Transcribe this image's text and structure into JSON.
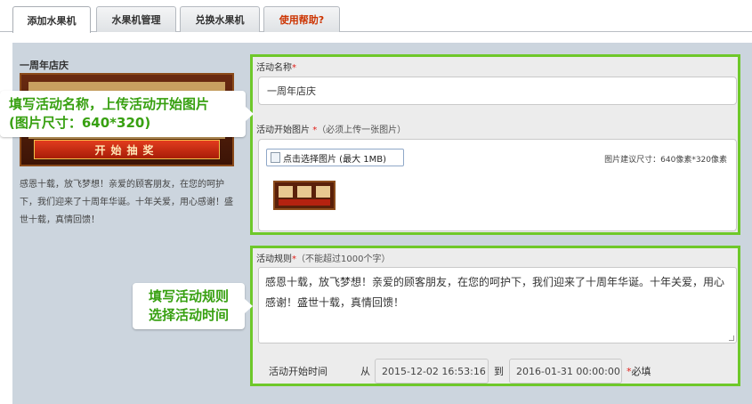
{
  "tabs": [
    {
      "label": "添加水果机",
      "active": true
    },
    {
      "label": "水果机管理",
      "active": false
    },
    {
      "label": "兑换水果机",
      "active": false
    },
    {
      "label": "使用帮助?",
      "active": false
    }
  ],
  "preview": {
    "title": "一周年店庆",
    "button_label": "开始抽奖",
    "rules_text": "感恩十载，放飞梦想！亲爱的顾客朋友，在您的呵护下，我们迎来了十周年华诞。十年关爱，用心感谢！盛世十载，真情回馈！"
  },
  "callouts": {
    "name_line1": "填写活动名称，上传活动开始图片",
    "name_line2": "(图片尺寸：640*320)",
    "rules_line1": "填写活动规则",
    "rules_line2": "选择活动时间"
  },
  "form": {
    "name_label": "活动名称",
    "required_mark": "*",
    "name_value": "一周年店庆",
    "image_label": "活动开始图片",
    "image_note": "（必须上传一张图片）",
    "upload_label": "点击选择图片 (最大 1MB)",
    "size_hint": "图片建议尺寸：640像素*320像素",
    "rules_label": "活动规则",
    "rules_note": "（不能超过1000个字）",
    "rules_value": "感恩十载，放飞梦想！亲爱的顾客朋友，在您的呵护下，我们迎来了十周年华诞。十年关爱，用心感谢！盛世十载，真情回馈！",
    "time_label": "活动开始时间",
    "from_label": "从",
    "start_time": "2015-12-02 16:53:16",
    "to_label": "到",
    "end_time": "2016-01-31 00:00:00",
    "required_text": "必填"
  },
  "colors": {
    "highlight_border": "#6ec82a",
    "callout_text": "#37a010",
    "required": "#e0201a",
    "panel_bg": "#ccd5de"
  }
}
